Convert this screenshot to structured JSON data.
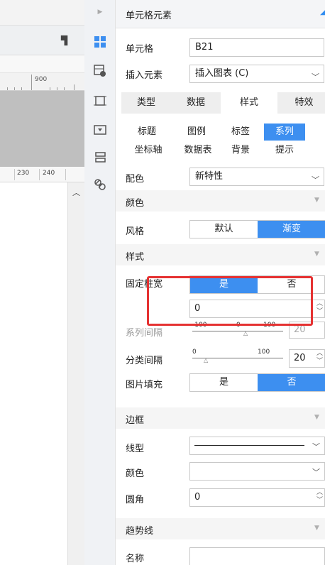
{
  "canvas": {
    "ruler_label": "900",
    "col_labels": [
      "230",
      "240"
    ]
  },
  "icons": [
    "arrow-icon",
    "cell-element-icon",
    "insert-element-icon",
    "border-frame-icon",
    "widget-icon",
    "layout-icon",
    "link-icon"
  ],
  "panel": {
    "title": "单元格元素",
    "cell_label": "单元格",
    "cell_value": "B21",
    "insert_label": "插入元素",
    "insert_value": "插入图表 (C)",
    "tabs": [
      "类型",
      "数据",
      "样式",
      "特效"
    ],
    "active_tab": "样式",
    "subtabs": [
      "标题",
      "图例",
      "标签",
      "系列",
      "坐标轴",
      "数据表",
      "背景",
      "提示"
    ],
    "active_subtab": "系列",
    "color_label": "配色",
    "color_value": "新特性",
    "section_color": "颜色",
    "style_label": "风格",
    "style_options": [
      "默认",
      "渐变"
    ],
    "style_selected": "渐变",
    "section_style": "样式",
    "fixed_width_label": "固定柱宽",
    "fixed_width_options": [
      "是",
      "否"
    ],
    "fixed_width_selected": "是",
    "fixed_width_value": "0",
    "series_gap_label": "系列间隔",
    "series_gap_ticks": [
      "-100",
      "0",
      "100"
    ],
    "series_gap_value": "20",
    "category_gap_label": "分类间隔",
    "category_gap_ticks": [
      "0",
      "100"
    ],
    "category_gap_value": "20",
    "image_fill_label": "图片填充",
    "image_fill_options": [
      "是",
      "否"
    ],
    "image_fill_selected": "否",
    "section_border": "边框",
    "line_type_label": "线型",
    "border_color_label": "颜色",
    "radius_label": "圆角",
    "radius_value": "0",
    "section_trend": "趋势线",
    "name_label": "名称"
  },
  "colors": {
    "accent": "#3d8ff0",
    "highlight": "#e53232"
  }
}
